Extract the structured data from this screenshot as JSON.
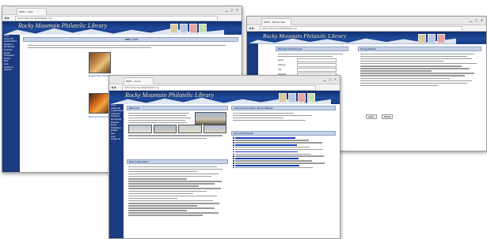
{
  "w1": {
    "tab": "RMPL - Thief",
    "address": "www.rockymountainphilatelic.org",
    "title": "Rocky Mountain Philatelic Library",
    "panel_title": "RMPL Thief",
    "captions": [
      "Brigadier Bag of Stamps",
      "Stamped Prospectus Inc."
    ],
    "nav": [
      "Home",
      "Library Info",
      "Location/Hours",
      "Donations",
      "Membership",
      "Programs",
      "Events",
      "Publications",
      "Exhibits",
      "Store",
      "Links",
      "Contact Us",
      "Calendar"
    ]
  },
  "w2": {
    "tab": "RMPL - Bazaar Sale",
    "address": "www.rockymountainphilatelic.org",
    "title": "Rocky Mountain Philatelic Library",
    "form_title": "Membership Renewal",
    "right_title": "Giving Bazaar",
    "fields": [
      "Name",
      "Address",
      "City",
      "State/Zip"
    ],
    "buttons": [
      "Apply",
      "Reset"
    ]
  },
  "w3": {
    "tab": "RMPL - Home",
    "address": "www.rockymountainphilatelic.org",
    "title": "Rocky Mountain Philatelic Library",
    "welcome_title": "Welcome",
    "news_title": "Latest Library News About Stamps",
    "new_title": "New Acquisitions",
    "upcoming_title": "Upcoming Events",
    "nav": [
      "Home",
      "Library Info",
      "Location/Hours",
      "Collections",
      "Donations",
      "Membership",
      "Programs",
      "Events",
      "Publications",
      "Exhibits",
      "Store",
      "Links",
      "Contact Us"
    ]
  },
  "colors": {
    "banner": "#1f4a9c",
    "sidebar": "#1b3a80",
    "panel": "#c7d3e6",
    "link": "#1a3fb8"
  }
}
